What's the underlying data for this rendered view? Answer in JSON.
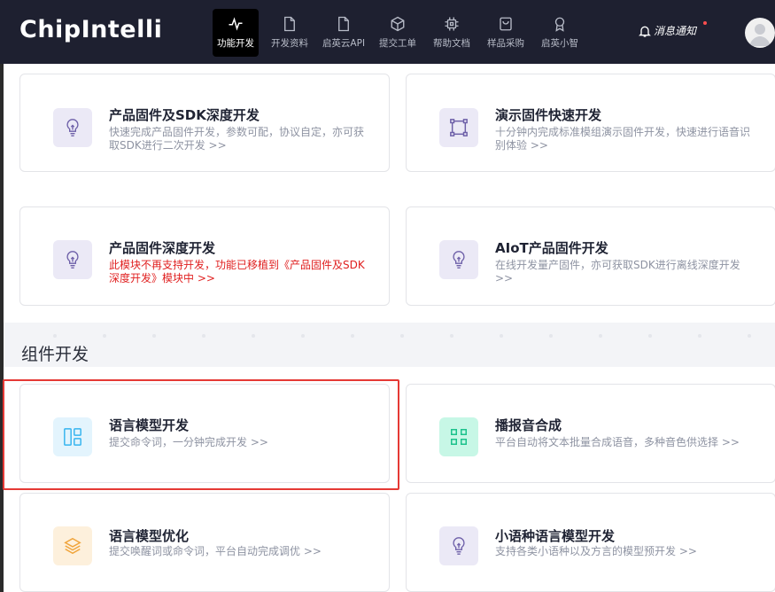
{
  "brand": {
    "logo_text": "ChipIntelli"
  },
  "nav": [
    {
      "label": "功能开发",
      "icon": "activity-icon",
      "active": true
    },
    {
      "label": "开发资料",
      "icon": "document-icon"
    },
    {
      "label": "启英云API",
      "icon": "document-icon"
    },
    {
      "label": "提交工单",
      "icon": "box-icon"
    },
    {
      "label": "帮助文档",
      "icon": "chip-icon"
    },
    {
      "label": "样品采购",
      "icon": "shopping-bag-icon"
    },
    {
      "label": "启英小智",
      "icon": "award-icon"
    }
  ],
  "header": {
    "notice_label": "消息通知"
  },
  "cards": [
    {
      "title": "产品固件及SDK深度开发",
      "desc": "快速完成产品固件开发，参数可配，协议自定，亦可获取SDK进行二次开发 >>",
      "icon": "bulb-icon"
    },
    {
      "title": "演示固件快速开发",
      "desc": "十分钟内完成标准模组演示固件开发，快速进行语音识别体验 >>",
      "icon": "frame-icon"
    },
    {
      "title": "产品固件深度开发",
      "desc": "此模块不再支持开发，功能已移植到《产品固件及SDK深度开发》模块中 >>",
      "icon": "bulb-icon",
      "warning": true
    },
    {
      "title": "AIoT产品固件开发",
      "desc": "在线开发量产固件，亦可获取SDK进行离线深度开发 >>",
      "icon": "bulb-icon"
    },
    {
      "title": "语言模型开发",
      "desc": "提交命令词，一分钟完成开发 >>",
      "icon": "layout-icon"
    },
    {
      "title": "播报音合成",
      "desc": "平台自动将文本批量合成语音，多种音色供选择 >>",
      "icon": "grid-icon"
    },
    {
      "title": "语言模型优化",
      "desc": "提交唤醒词或命令词，平台自动完成调优 >>",
      "icon": "layers-icon"
    },
    {
      "title": "小语种语言模型开发",
      "desc": "支持各类小语种以及方言的模型预开发 >>",
      "icon": "bulb-icon"
    }
  ],
  "section": {
    "title": "组件开发"
  },
  "colors": {
    "topbar": "#1e2030",
    "purple_icon_bg": "#ebe9f6",
    "purple_icon": "#6d5fa8",
    "blue_icon_bg": "#e3f4fd",
    "blue_icon": "#35b4ef",
    "green_icon_bg": "#c7f7e6",
    "green_icon": "#19c28a",
    "orange_icon_bg": "#fdf0dc",
    "orange_icon": "#f0a43a",
    "highlight_border": "#e53935"
  }
}
